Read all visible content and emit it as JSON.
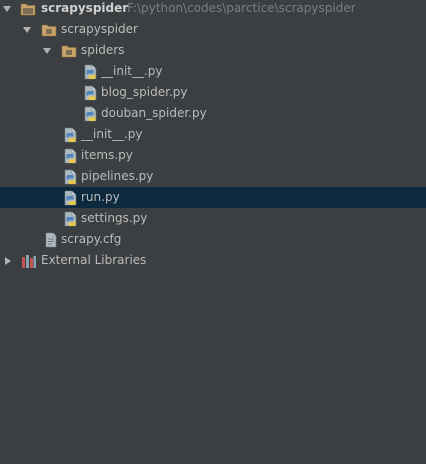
{
  "project_tree": {
    "root": {
      "label": "scrapyspider",
      "path": "F:\\python\\codes\\parctice\\scrapyspider",
      "icon": "project-folder-icon"
    },
    "items": [
      {
        "label": "scrapyspider",
        "icon": "package-folder-icon",
        "type": "folder",
        "expanded": true
      },
      {
        "label": "spiders",
        "icon": "package-folder-icon",
        "type": "folder",
        "expanded": true
      },
      {
        "label": "__init__.py",
        "icon": "python-file-icon",
        "type": "file"
      },
      {
        "label": "blog_spider.py",
        "icon": "python-file-icon",
        "type": "file"
      },
      {
        "label": "douban_spider.py",
        "icon": "python-file-icon",
        "type": "file"
      },
      {
        "label": "__init__.py",
        "icon": "python-file-icon",
        "type": "file"
      },
      {
        "label": "items.py",
        "icon": "python-file-icon",
        "type": "file"
      },
      {
        "label": "pipelines.py",
        "icon": "python-file-icon",
        "type": "file"
      },
      {
        "label": "run.py",
        "icon": "python-file-icon",
        "type": "file",
        "selected": true
      },
      {
        "label": "settings.py",
        "icon": "python-file-icon",
        "type": "file"
      },
      {
        "label": "scrapy.cfg",
        "icon": "config-file-icon",
        "type": "file"
      }
    ],
    "external": {
      "label": "External Libraries",
      "icon": "library-icon",
      "expanded": false
    }
  },
  "colors": {
    "background": "#3c3f41",
    "selection": "#0d293e",
    "text": "#bbbbbb",
    "path_text": "#7d7d7d",
    "folder": "#c9a46a",
    "python_blue": "#4f84bd",
    "python_yellow": "#e8c94a"
  }
}
